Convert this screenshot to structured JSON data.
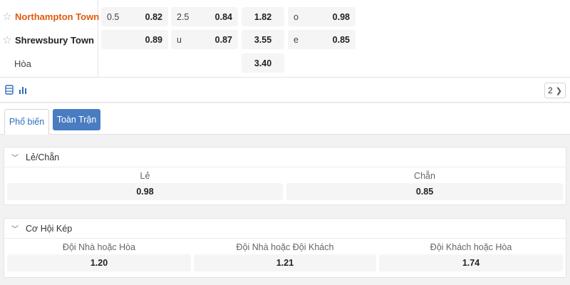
{
  "match": {
    "home": {
      "name": "Northampton Town",
      "handicap_line": "0.5",
      "handicap_odds": "0.82",
      "total_line": "2.5",
      "total_odds": "0.84",
      "win_odds": "1.82",
      "oddeven_label": "o",
      "oddeven_odds": "0.98"
    },
    "away": {
      "name": "Shrewsbury Town",
      "handicap_line": "",
      "handicap_odds": "0.89",
      "total_line": "u",
      "total_odds": "0.87",
      "win_odds": "3.55",
      "oddeven_label": "e",
      "oddeven_odds": "0.85"
    },
    "draw": {
      "name": "Hòa",
      "win_odds": "3.40"
    }
  },
  "toolbar": {
    "icons": [
      "list-icon",
      "stats-icon"
    ],
    "count": "2"
  },
  "tabs": [
    {
      "label": "Phổ biến",
      "active": true
    },
    {
      "label": "Toàn Trận",
      "active": false
    }
  ],
  "markets": {
    "odd_even": {
      "title": "Lẻ/Chẵn",
      "outcomes": [
        {
          "name": "Lẻ",
          "odds": "0.98"
        },
        {
          "name": "Chẵn",
          "odds": "0.85"
        }
      ]
    },
    "double_chance": {
      "title": "Cơ Hội Kép",
      "outcomes": [
        {
          "name": "Đội Nhà hoặc Hòa",
          "odds": "1.20"
        },
        {
          "name": "Đội Nhà hoặc Đội Khách",
          "odds": "1.21"
        },
        {
          "name": "Đội Khách hoặc Hòa",
          "odds": "1.74"
        }
      ]
    }
  },
  "colors": {
    "home_team": "#e05a0c",
    "tab_active_text": "#2f6ebd",
    "tab_button_bg": "#4a7cc2",
    "cell_bg": "#f5f5f5"
  }
}
